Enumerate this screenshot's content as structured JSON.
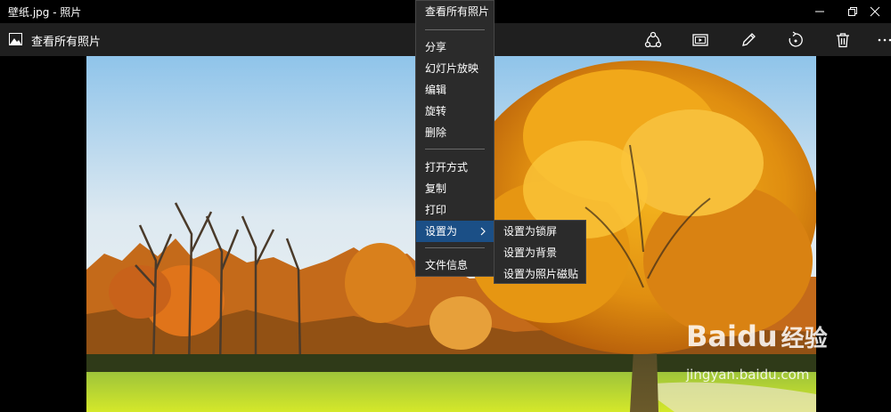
{
  "window": {
    "title": "壁纸.jpg - 照片"
  },
  "appbar": {
    "back_label": "查看所有照片"
  },
  "context_menu": {
    "header": "查看所有照片",
    "items": [
      "分享",
      "幻灯片放映",
      "编辑",
      "旋转",
      "删除"
    ],
    "items2": [
      "打开方式",
      "复制",
      "打印"
    ],
    "set_as": "设置为",
    "info": "文件信息"
  },
  "submenu": {
    "items": [
      "设置为锁屏",
      "设置为背景",
      "设置为照片磁贴"
    ]
  },
  "watermark": {
    "brand": "Baidu",
    "suffix": "经验",
    "url": "jingyan.baidu.com"
  },
  "colors": {
    "accent": "#1b4f86",
    "menu_bg": "#2b2b2b",
    "appbar_bg": "#1f1f1f"
  }
}
